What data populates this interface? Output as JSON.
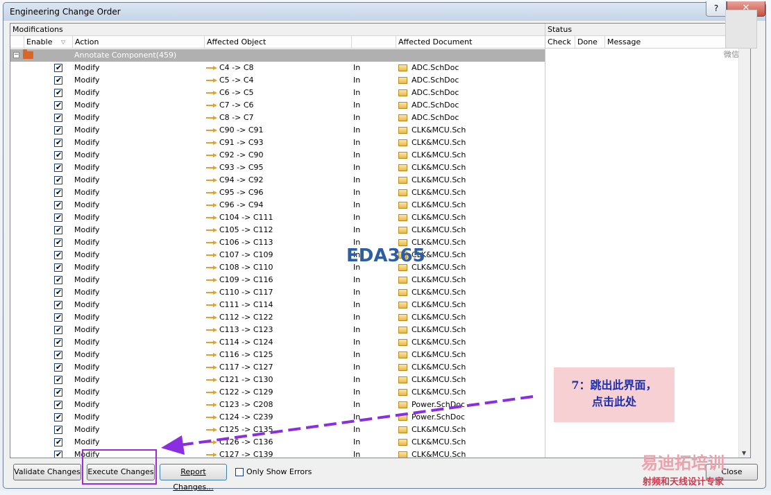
{
  "window": {
    "title": "Engineering Change Order",
    "close_glyph": "✕",
    "help_glyph": "?"
  },
  "headers": {
    "modifications": "Modifications",
    "status": "Status",
    "enable": "Enable",
    "action": "Action",
    "affected_object": "Affected Object",
    "affected_document": "Affected Document",
    "check": "Check",
    "done": "Done",
    "message": "Message"
  },
  "group": {
    "label": "Annotate Component(459)",
    "toggle": "−"
  },
  "rows": [
    {
      "action": "Modify",
      "object": "C4 -> C8",
      "in": "In",
      "doc": "ADC.SchDoc"
    },
    {
      "action": "Modify",
      "object": "C5 -> C4",
      "in": "In",
      "doc": "ADC.SchDoc"
    },
    {
      "action": "Modify",
      "object": "C6 -> C5",
      "in": "In",
      "doc": "ADC.SchDoc"
    },
    {
      "action": "Modify",
      "object": "C7 -> C6",
      "in": "In",
      "doc": "ADC.SchDoc"
    },
    {
      "action": "Modify",
      "object": "C8 -> C7",
      "in": "In",
      "doc": "ADC.SchDoc"
    },
    {
      "action": "Modify",
      "object": "C90 -> C91",
      "in": "In",
      "doc": "CLK&MCU.Sch"
    },
    {
      "action": "Modify",
      "object": "C91 -> C93",
      "in": "In",
      "doc": "CLK&MCU.Sch"
    },
    {
      "action": "Modify",
      "object": "C92 -> C90",
      "in": "In",
      "doc": "CLK&MCU.Sch"
    },
    {
      "action": "Modify",
      "object": "C93 -> C95",
      "in": "In",
      "doc": "CLK&MCU.Sch"
    },
    {
      "action": "Modify",
      "object": "C94 -> C92",
      "in": "In",
      "doc": "CLK&MCU.Sch"
    },
    {
      "action": "Modify",
      "object": "C95 -> C96",
      "in": "In",
      "doc": "CLK&MCU.Sch"
    },
    {
      "action": "Modify",
      "object": "C96 -> C94",
      "in": "In",
      "doc": "CLK&MCU.Sch"
    },
    {
      "action": "Modify",
      "object": "C104 -> C111",
      "in": "In",
      "doc": "CLK&MCU.Sch"
    },
    {
      "action": "Modify",
      "object": "C105 -> C112",
      "in": "In",
      "doc": "CLK&MCU.Sch"
    },
    {
      "action": "Modify",
      "object": "C106 -> C113",
      "in": "In",
      "doc": "CLK&MCU.Sch"
    },
    {
      "action": "Modify",
      "object": "C107 -> C109",
      "in": "In",
      "doc": "CLK&MCU.Sch"
    },
    {
      "action": "Modify",
      "object": "C108 -> C110",
      "in": "In",
      "doc": "CLK&MCU.Sch"
    },
    {
      "action": "Modify",
      "object": "C109 -> C116",
      "in": "In",
      "doc": "CLK&MCU.Sch"
    },
    {
      "action": "Modify",
      "object": "C110 -> C117",
      "in": "In",
      "doc": "CLK&MCU.Sch"
    },
    {
      "action": "Modify",
      "object": "C111 -> C114",
      "in": "In",
      "doc": "CLK&MCU.Sch"
    },
    {
      "action": "Modify",
      "object": "C112 -> C122",
      "in": "In",
      "doc": "CLK&MCU.Sch"
    },
    {
      "action": "Modify",
      "object": "C113 -> C123",
      "in": "In",
      "doc": "CLK&MCU.Sch"
    },
    {
      "action": "Modify",
      "object": "C114 -> C124",
      "in": "In",
      "doc": "CLK&MCU.Sch"
    },
    {
      "action": "Modify",
      "object": "C116 -> C125",
      "in": "In",
      "doc": "CLK&MCU.Sch"
    },
    {
      "action": "Modify",
      "object": "C117 -> C127",
      "in": "In",
      "doc": "CLK&MCU.Sch"
    },
    {
      "action": "Modify",
      "object": "C121 -> C130",
      "in": "In",
      "doc": "CLK&MCU.Sch"
    },
    {
      "action": "Modify",
      "object": "C122 -> C129",
      "in": "In",
      "doc": "CLK&MCU.Sch"
    },
    {
      "action": "Modify",
      "object": "C123 -> C208",
      "in": "In",
      "doc": "Power.SchDoc"
    },
    {
      "action": "Modify",
      "object": "C124 -> C239",
      "in": "In",
      "doc": "Power.SchDoc"
    },
    {
      "action": "Modify",
      "object": "C125 -> C135",
      "in": "In",
      "doc": "CLK&MCU.Sch"
    },
    {
      "action": "Modify",
      "object": "C126 -> C136",
      "in": "In",
      "doc": "CLK&MCU.Sch"
    },
    {
      "action": "Modify",
      "object": "C127 -> C139",
      "in": "In",
      "doc": "CLK&MCU.Sch"
    }
  ],
  "buttons": {
    "validate": "Validate Changes",
    "execute": "Execute Changes",
    "report": "Report Changes...",
    "only_errors": "Only Show Errors",
    "close": "Close"
  },
  "annotation": {
    "callout_line1": "7：跳出此界面，",
    "callout_line2": "点击此处",
    "highlight_color": "#a02bd6"
  },
  "watermarks": {
    "center": "EDA365",
    "corner_top": "易迪拓培训",
    "corner_bottom": "射频和天线设计专家",
    "qr_caption": "微信"
  }
}
